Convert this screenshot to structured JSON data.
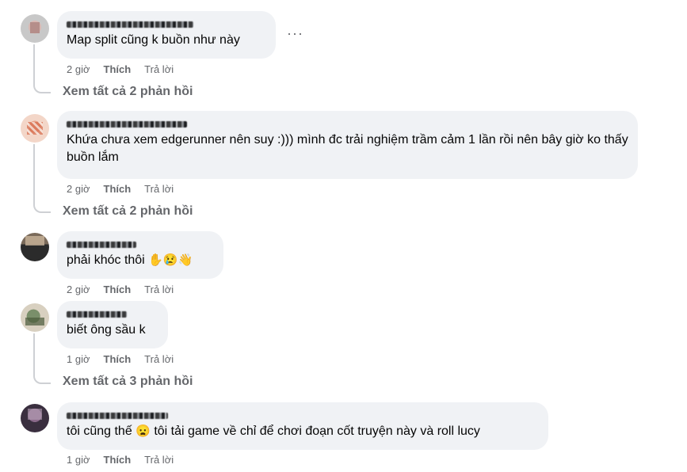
{
  "comments": [
    {
      "author": "",
      "text": "Map split cũng k buồn như này",
      "time": "2 giờ",
      "like": "Thích",
      "reply": "Trả lời",
      "view_replies": "Xem tất cả 2 phản hồi",
      "more": "···"
    },
    {
      "author": "",
      "text": "Khứa chưa xem edgerunner nên suy :))) mình đc trải nghiệm trầm cảm 1 lần rồi nên bây giờ ko thấy buồn lắm",
      "time": "2 giờ",
      "like": "Thích",
      "reply": "Trả lời",
      "view_replies": "Xem tất cả 2 phản hồi"
    },
    {
      "author": "",
      "text": "phải khóc thôi",
      "emojis": "✋😢👋",
      "time": "2 giờ",
      "like": "Thích",
      "reply": "Trả lời"
    },
    {
      "author": "",
      "text": "biết ông sầu k",
      "time": "1 giờ",
      "like": "Thích",
      "reply": "Trả lời",
      "view_replies": "Xem tất cả 3 phản hồi"
    },
    {
      "author": "",
      "text_before": "tôi cũng thế",
      "emoji": "😦",
      "text_after": "tôi tải game về chỉ để chơi đoạn cốt truyện này và roll lucy",
      "time": "1 giờ",
      "like": "Thích",
      "reply": "Trả lời"
    }
  ],
  "colors": {
    "bubble": "#f0f2f5",
    "secondary_text": "#65676b",
    "primary_text": "#050505",
    "thread_line": "#ced0d4"
  }
}
